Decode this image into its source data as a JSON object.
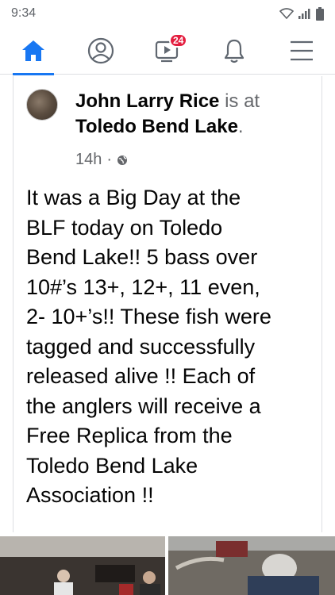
{
  "status_bar": {
    "time": "9:34"
  },
  "nav": {
    "items": [
      {
        "name": "home",
        "active": true
      },
      {
        "name": "profile"
      },
      {
        "name": "watch",
        "badge": "24"
      },
      {
        "name": "notifications"
      },
      {
        "name": "menu"
      }
    ]
  },
  "post": {
    "author": "John Larry Rice",
    "is_at": "is at",
    "location": "Toledo Bend Lake",
    "location_suffix": ".",
    "time": "14h",
    "separator": "·",
    "text_lines": [
      "It was a Big Day at the",
      "BLF today on Toledo",
      "Bend Lake!! 5 bass over",
      "10#’s 13+, 12+, 11 even,",
      "2- 10+’s!! These fish were",
      "tagged and successfully",
      "released alive !! Each of",
      "the anglers will receive a",
      "Free Replica from the",
      "Toledo Bend Lake",
      "Association !!"
    ]
  },
  "colors": {
    "accent": "#1877f2",
    "badge": "#e41e3f",
    "secondary_text": "#65676b"
  }
}
